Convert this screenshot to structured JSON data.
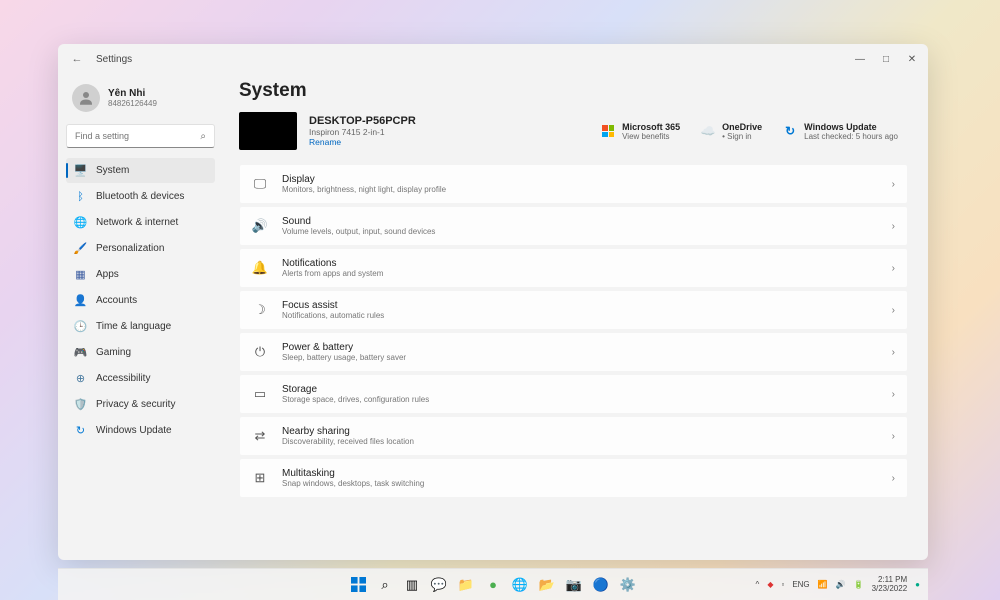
{
  "titlebar": {
    "title": "Settings"
  },
  "profile": {
    "name": "Yên Nhi",
    "id": "84826126449"
  },
  "search": {
    "placeholder": "Find a setting"
  },
  "nav": [
    {
      "label": "System",
      "icon": "🖥️",
      "color": "#0078d4",
      "active": true
    },
    {
      "label": "Bluetooth & devices",
      "icon": "ᛒ",
      "color": "#0078d4"
    },
    {
      "label": "Network & internet",
      "icon": "🌐",
      "color": "#5b9bd5"
    },
    {
      "label": "Personalization",
      "icon": "🖌️",
      "color": "#d08030"
    },
    {
      "label": "Apps",
      "icon": "▦",
      "color": "#3a5ba0"
    },
    {
      "label": "Accounts",
      "icon": "👤",
      "color": "#d08030"
    },
    {
      "label": "Time & language",
      "icon": "🕒",
      "color": "#4a8bc5"
    },
    {
      "label": "Gaming",
      "icon": "🎮",
      "color": "#7a7a7a"
    },
    {
      "label": "Accessibility",
      "icon": "⊕",
      "color": "#4a7ba0"
    },
    {
      "label": "Privacy & security",
      "icon": "🛡️",
      "color": "#5b8a9a"
    },
    {
      "label": "Windows Update",
      "icon": "↻",
      "color": "#0078d4"
    }
  ],
  "page": {
    "title": "System"
  },
  "device": {
    "name": "DESKTOP-P56PCPR",
    "model": "Inspiron 7415 2-in-1",
    "rename": "Rename"
  },
  "cloud": [
    {
      "title": "Microsoft 365",
      "sub": "View benefits",
      "icon": "ms365"
    },
    {
      "title": "OneDrive",
      "sub": "• Sign in",
      "icon": "☁️"
    },
    {
      "title": "Windows Update",
      "sub": "Last checked: 5 hours ago",
      "icon": "↻"
    }
  ],
  "settings": [
    {
      "title": "Display",
      "sub": "Monitors, brightness, night light, display profile",
      "icon": "🖵"
    },
    {
      "title": "Sound",
      "sub": "Volume levels, output, input, sound devices",
      "icon": "🔊"
    },
    {
      "title": "Notifications",
      "sub": "Alerts from apps and system",
      "icon": "🔔"
    },
    {
      "title": "Focus assist",
      "sub": "Notifications, automatic rules",
      "icon": "☽"
    },
    {
      "title": "Power & battery",
      "sub": "Sleep, battery usage, battery saver",
      "icon": "⏻"
    },
    {
      "title": "Storage",
      "sub": "Storage space, drives, configuration rules",
      "icon": "▭"
    },
    {
      "title": "Nearby sharing",
      "sub": "Discoverability, received files location",
      "icon": "⇄"
    },
    {
      "title": "Multitasking",
      "sub": "Snap windows, desktops, task switching",
      "icon": "⊞"
    }
  ],
  "tray": {
    "lang": "ENG",
    "time": "2:11 PM",
    "date": "3/23/2022"
  }
}
